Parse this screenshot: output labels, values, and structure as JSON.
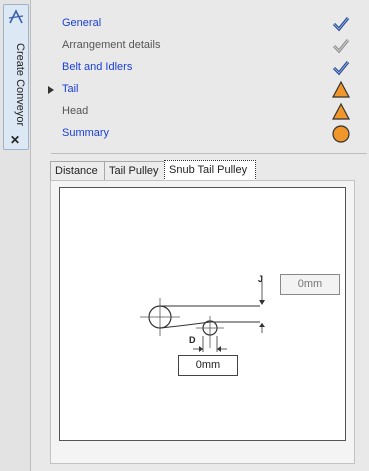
{
  "side_tab": {
    "title": "Create Conveyor",
    "close_glyph": "✕",
    "app_icon": "autocad-a-icon"
  },
  "steps": [
    {
      "label": "General",
      "style": "link",
      "status": "check",
      "status_color": "#3b5aa8",
      "current": false
    },
    {
      "label": "Arrangement details",
      "style": "muted",
      "status": "check",
      "status_color": "#9a9a9a",
      "current": false
    },
    {
      "label": "Belt and Idlers",
      "style": "link",
      "status": "check",
      "status_color": "#3b5aa8",
      "current": false
    },
    {
      "label": "Tail",
      "style": "link",
      "status": "warning",
      "status_color": "#f0962a",
      "current": true
    },
    {
      "label": "Head",
      "style": "muted",
      "status": "warning",
      "status_color": "#f0962a",
      "current": false
    },
    {
      "label": "Summary",
      "style": "link",
      "status": "circle",
      "status_color": "#f0962a",
      "current": false
    }
  ],
  "tabs": [
    {
      "label": "Distance",
      "active": false
    },
    {
      "label": "Tail Pulley",
      "active": false
    },
    {
      "label": "Snub Tail Pulley",
      "active": true
    }
  ],
  "diagram": {
    "j_label": "J",
    "d_label": "D",
    "j_value": "0mm",
    "d_value": "0mm"
  }
}
